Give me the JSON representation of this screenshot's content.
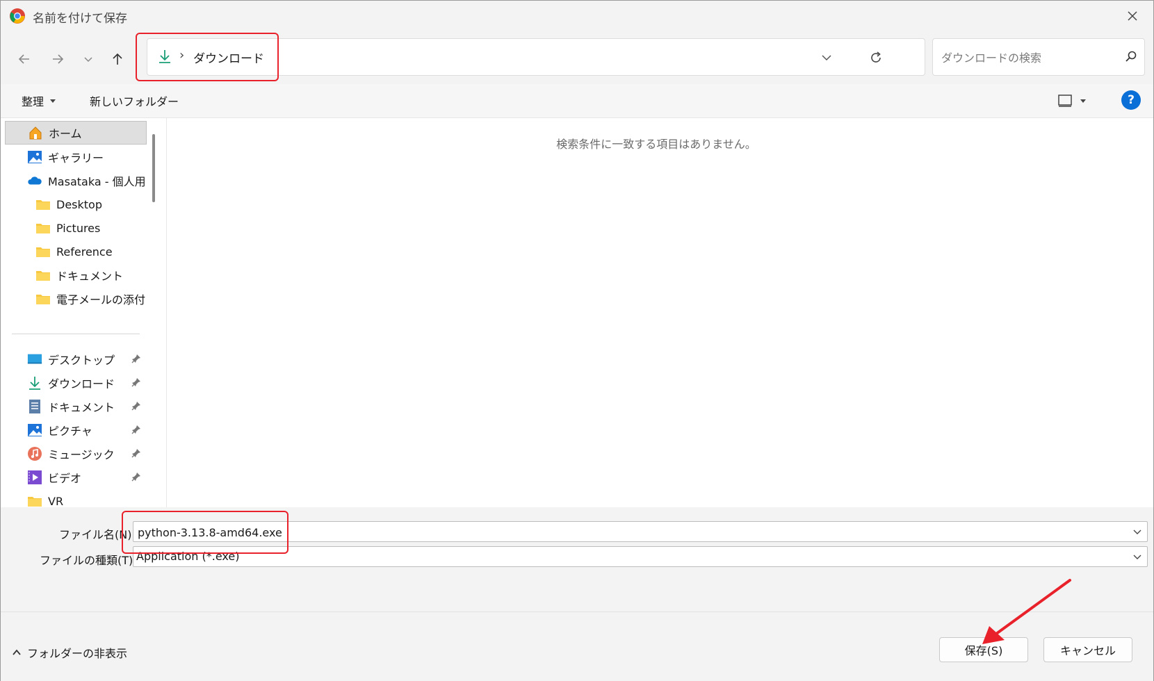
{
  "window": {
    "title": "名前を付けて保存",
    "close_label": "✕"
  },
  "nav": {
    "back_label": "←",
    "forward_label": "→",
    "recent_label": "⌄",
    "up_label": "↑",
    "address_separator": "›",
    "address_path": "ダウンロード",
    "search_placeholder": "ダウンロードの検索"
  },
  "toolbar": {
    "organize_label": "整理",
    "new_folder_label": "新しいフォルダー",
    "help_label": "?"
  },
  "sidebar": {
    "top_items": [
      {
        "label": "ホーム",
        "icon": "home-icon",
        "selected": true
      },
      {
        "label": "ギャラリー",
        "icon": "gallery-icon"
      },
      {
        "label": "Masataka - 個人用",
        "icon": "onedrive-icon"
      },
      {
        "label": "Desktop",
        "icon": "folder-icon"
      },
      {
        "label": "Pictures",
        "icon": "folder-icon"
      },
      {
        "label": "Reference",
        "icon": "folder-icon"
      },
      {
        "label": "ドキュメント",
        "icon": "folder-icon"
      },
      {
        "label": "電子メールの添付",
        "icon": "folder-icon"
      }
    ],
    "quick_access": [
      {
        "label": "デスクトップ",
        "icon": "desktop-icon"
      },
      {
        "label": "ダウンロード",
        "icon": "download-icon"
      },
      {
        "label": "ドキュメント",
        "icon": "document-icon"
      },
      {
        "label": "ピクチャ",
        "icon": "picture-icon"
      },
      {
        "label": "ミュージック",
        "icon": "music-icon"
      },
      {
        "label": "ビデオ",
        "icon": "video-icon"
      },
      {
        "label": "VR",
        "icon": "folder-icon"
      }
    ]
  },
  "content": {
    "empty_message": "検索条件に一致する項目はありません。"
  },
  "form": {
    "filename_label": "ファイル名(N):",
    "filename_value": "python-3.13.8-amd64.exe",
    "filetype_label": "ファイルの種類(T):",
    "filetype_value": "Application (*.exe)"
  },
  "footer": {
    "toggle_folders_label": "フォルダーの非表示",
    "save_label": "保存(S)",
    "cancel_label": "キャンセル"
  },
  "colors": {
    "annotation": "#e8212a",
    "accent": "#0a6fd6",
    "download_green": "#1b9e77"
  }
}
